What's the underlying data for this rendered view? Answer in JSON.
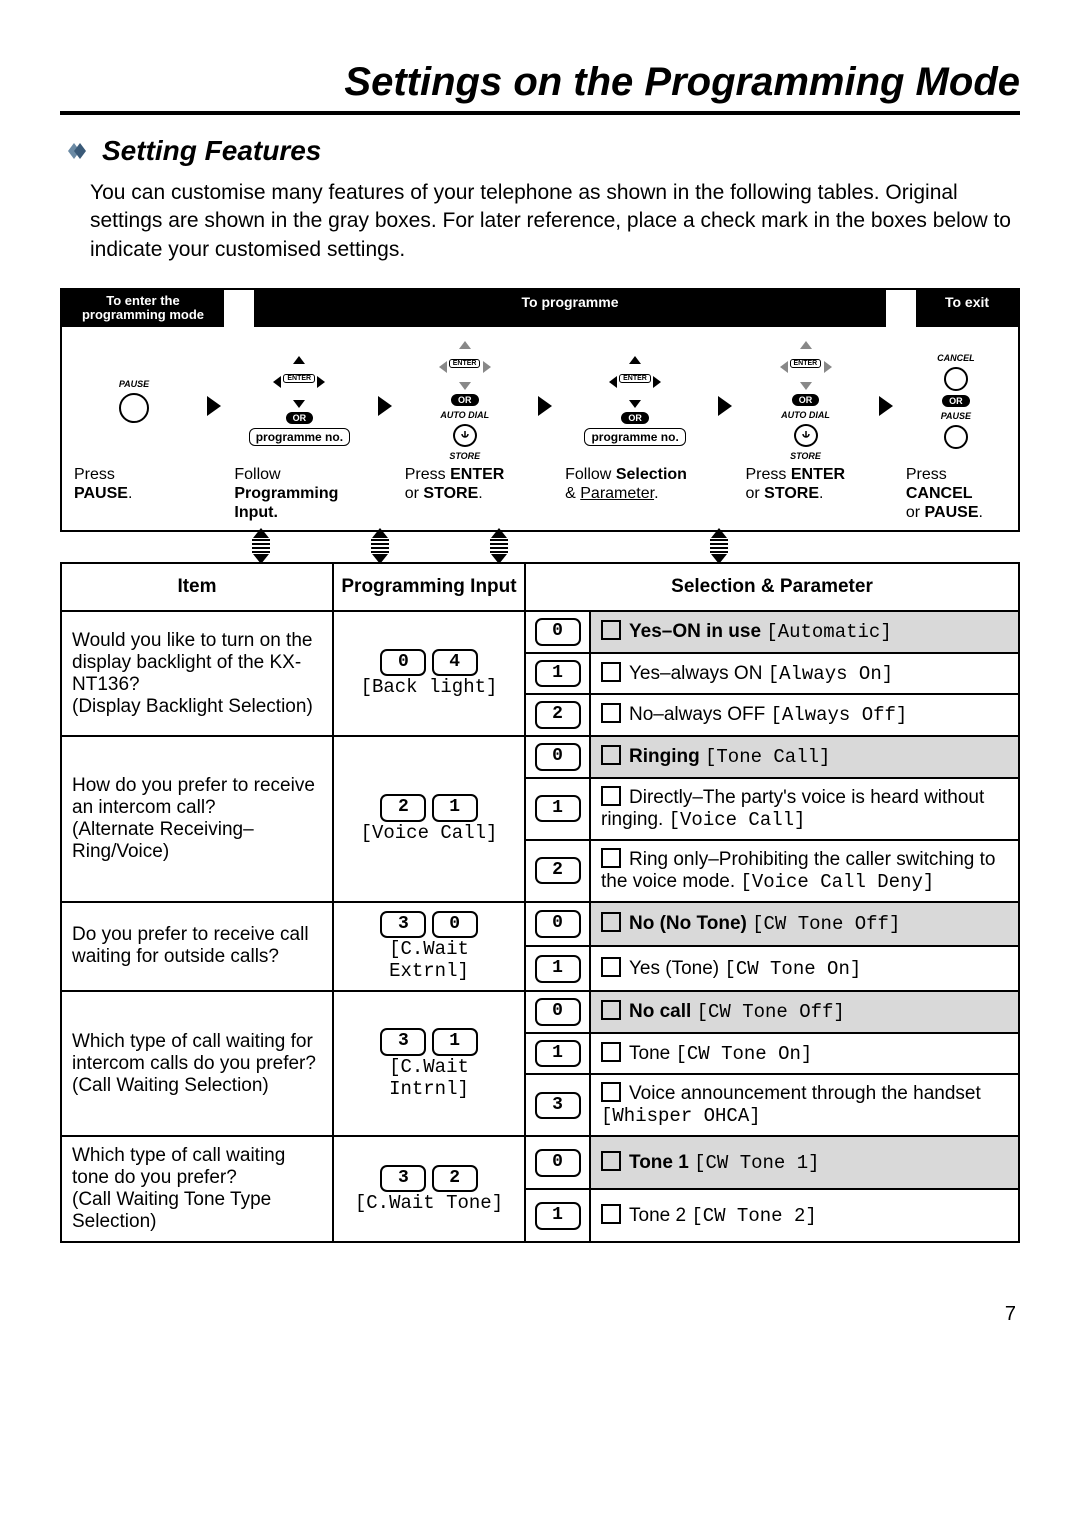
{
  "title": "Settings on the Programming Mode",
  "section": "Setting Features",
  "intro": "You can customise many features of your telephone as shown in the following tables. Original settings are shown in the gray boxes.  For later reference, place a check mark in the boxes below to indicate your customised settings.",
  "flow": {
    "header_left_l1": "To enter the",
    "header_left_l2": "programming mode",
    "header_mid": "To programme",
    "header_right": "To exit",
    "or": "OR",
    "pause": "PAUSE",
    "enter": "ENTER",
    "autodial": "AUTO DIAL",
    "store": "STORE",
    "cancel": "CANCEL",
    "progno": "programme no.",
    "step1_l1": "Press",
    "step1_l2": "PAUSE",
    "step1_l3": ".",
    "step2_l1": "Follow",
    "step2_l2": "Programming",
    "step2_l3": "Input.",
    "step3_l1": "Press ",
    "step3_b": "ENTER",
    "step3_l2": "or ",
    "step3_b2": "STORE",
    "step3_l3": ".",
    "step4_l1": "Follow ",
    "step4_b": "Selection",
    "step4_l2": "& ",
    "step4_u": "Parameter",
    "step4_l3": ".",
    "step5_l1": "Press ",
    "step5_b": "ENTER",
    "step5_l2": "or ",
    "step5_b2": "STORE",
    "step5_l3": ".",
    "step6_l1": "Press",
    "step6_b": "CANCEL",
    "step6_l2": "or ",
    "step6_b2": "PAUSE",
    "step6_l3": "."
  },
  "table": {
    "headers": {
      "item": "Item",
      "prog": "Programming Input",
      "selparam": "Selection & Parameter"
    },
    "rows": [
      {
        "item_main": "Would you like to turn on the display backlight of the KX-NT136?",
        "item_sub": "(Display Backlight Selection)",
        "prog_keys": [
          "0",
          "4"
        ],
        "prog_label": "[Back light]",
        "options": [
          {
            "sel": "0",
            "default": true,
            "label_bold": "Yes–ON in use",
            "label_rest": "",
            "mono": "[Automatic]"
          },
          {
            "sel": "1",
            "default": false,
            "label_bold": "",
            "label_rest": "Yes–always ON",
            "mono": "[Always On]"
          },
          {
            "sel": "2",
            "default": false,
            "label_bold": "",
            "label_rest": "No–always OFF",
            "mono": "[Always Off]"
          }
        ]
      },
      {
        "item_main": "How do you prefer to receive an intercom call?",
        "item_sub": "(Alternate Receiving–Ring/Voice)",
        "prog_keys": [
          "2",
          "1"
        ],
        "prog_label": "[Voice Call]",
        "options": [
          {
            "sel": "0",
            "default": true,
            "label_bold": "Ringing",
            "label_rest": "",
            "mono": "[Tone Call]"
          },
          {
            "sel": "1",
            "default": false,
            "label_bold": "",
            "label_rest": "Directly–The party's voice is heard without ringing.",
            "mono": "[Voice Call]"
          },
          {
            "sel": "2",
            "default": false,
            "label_bold": "",
            "label_rest": "Ring only–Prohibiting the caller switching to the voice mode.",
            "mono": "[Voice Call Deny]"
          }
        ]
      },
      {
        "item_main": "Do you prefer to receive call waiting for outside calls?",
        "item_sub": "",
        "prog_keys": [
          "3",
          "0"
        ],
        "prog_label": "[C.Wait Extrnl]",
        "options": [
          {
            "sel": "0",
            "default": true,
            "label_bold": "No (No Tone)",
            "label_rest": "",
            "mono": "[CW Tone Off]"
          },
          {
            "sel": "1",
            "default": false,
            "label_bold": "",
            "label_rest": "Yes (Tone)",
            "mono": "[CW Tone On]"
          }
        ]
      },
      {
        "item_main": "Which type of call waiting for intercom calls do you prefer?",
        "item_sub": "(Call Waiting Selection)",
        "prog_keys": [
          "3",
          "1"
        ],
        "prog_label": "[C.Wait Intrnl]",
        "options": [
          {
            "sel": "0",
            "default": true,
            "label_bold": "No call",
            "label_rest": "",
            "mono": "[CW Tone Off]"
          },
          {
            "sel": "1",
            "default": false,
            "label_bold": "",
            "label_rest": "Tone",
            "mono": "[CW Tone On]"
          },
          {
            "sel": "3",
            "default": false,
            "label_bold": "",
            "label_rest": "Voice announcement through the handset",
            "mono": "[Whisper OHCA]"
          }
        ]
      },
      {
        "item_main": "Which type of call waiting tone do you prefer?",
        "item_sub": "(Call Waiting Tone Type Selection)",
        "prog_keys": [
          "3",
          "2"
        ],
        "prog_label": "[C.Wait Tone]",
        "options": [
          {
            "sel": "0",
            "default": true,
            "label_bold": "Tone 1",
            "label_rest": "",
            "mono": "[CW Tone 1]"
          },
          {
            "sel": "1",
            "default": false,
            "label_bold": "",
            "label_rest": "Tone 2",
            "mono": "[CW Tone 2]"
          }
        ]
      }
    ]
  },
  "pagenum": "7"
}
